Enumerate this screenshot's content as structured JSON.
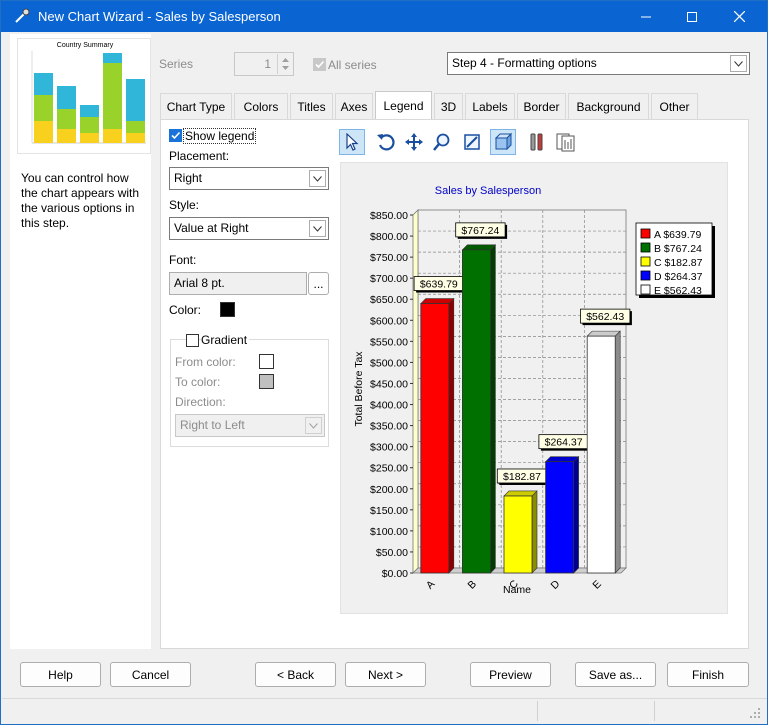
{
  "window": {
    "title": "New Chart Wizard - Sales by Salesperson"
  },
  "preview": {
    "title": "Country Summary"
  },
  "help_text": "You can control how the chart appears with the various options in this step.",
  "series": {
    "label": "Series",
    "value": "1",
    "all_series_label": "All series"
  },
  "step": {
    "value": "Step 4 - Formatting options"
  },
  "tabs": [
    "Chart Type",
    "Colors",
    "Titles",
    "Axes",
    "Legend",
    "3D",
    "Labels",
    "Border",
    "Background",
    "Other"
  ],
  "legend_tab": {
    "show_legend": "Show legend",
    "placement_label": "Placement:",
    "placement_value": "Right",
    "style_label": "Style:",
    "style_value": "Value at Right",
    "font_label": "Font:",
    "font_value": "Arial 8 pt.",
    "font_btn": "...",
    "color_label": "Color:",
    "gradient_label": "Gradient",
    "from_color_label": "From color:",
    "to_color_label": "To color:",
    "direction_label": "Direction:",
    "direction_value": "Right to Left"
  },
  "colors": {
    "accent": "#0a64d2",
    "legend_color": "#000000"
  },
  "buttons": {
    "help": "Help",
    "cancel": "Cancel",
    "back": "< Back",
    "next": "Next >",
    "preview": "Preview",
    "save_as": "Save as...",
    "finish": "Finish"
  },
  "chart_data": {
    "type": "bar",
    "title": "Sales by Salesperson",
    "xlabel": "Name",
    "ylabel": "Total Before Tax",
    "categories": [
      "A",
      "B",
      "C",
      "D",
      "E"
    ],
    "values": [
      639.79,
      767.24,
      182.87,
      264.37,
      562.43
    ],
    "value_labels": [
      "$639.79",
      "$767.24",
      "$182.87",
      "$264.37",
      "$562.43"
    ],
    "bar_colors": [
      "#ff0000",
      "#007000",
      "#ffff00",
      "#0000ff",
      "#ffffff"
    ],
    "ylim": [
      0,
      850
    ],
    "yticks": [
      "$0.00",
      "$50.00",
      "$100.00",
      "$150.00",
      "$200.00",
      "$250.00",
      "$300.00",
      "$350.00",
      "$400.00",
      "$450.00",
      "$500.00",
      "$550.00",
      "$600.00",
      "$650.00",
      "$700.00",
      "$750.00",
      "$800.00",
      "$850.00"
    ],
    "legend": [
      "A $639.79",
      "B $767.24",
      "C $182.87",
      "D $264.37",
      "E $562.43"
    ],
    "legend_placement": "right",
    "grid": true
  }
}
